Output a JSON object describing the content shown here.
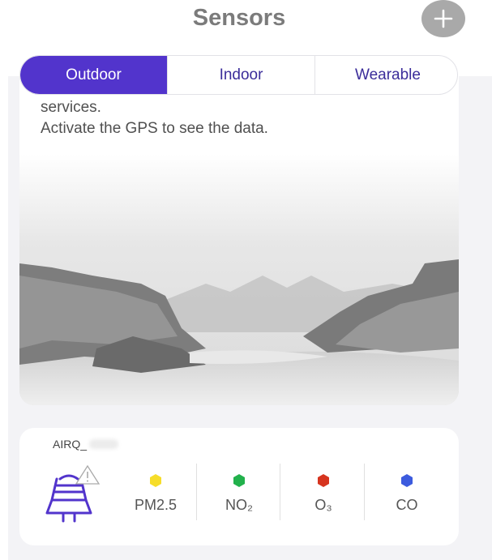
{
  "header": {
    "title": "Sensors"
  },
  "tabs": [
    {
      "label": "Outdoor",
      "active": true
    },
    {
      "label": "Indoor",
      "active": false
    },
    {
      "label": "Wearable",
      "active": false
    }
  ],
  "outdoor_card": {
    "message_line1": "services.",
    "message_line2": "Activate the GPS to see the data."
  },
  "sensor": {
    "device_name": "AIRQ_",
    "metrics": [
      {
        "label": "PM2.5",
        "color": "#f6dd2a"
      },
      {
        "label": "NO₂",
        "color": "#22b14c"
      },
      {
        "label": "O₃",
        "color": "#d6341f"
      },
      {
        "label": "CO",
        "color": "#3c5bde"
      }
    ]
  },
  "colors": {
    "accent": "#5234cc",
    "add_button": "#a9a9a9"
  },
  "icons": [
    "plus-icon",
    "sensor-device-icon",
    "warning-icon"
  ]
}
